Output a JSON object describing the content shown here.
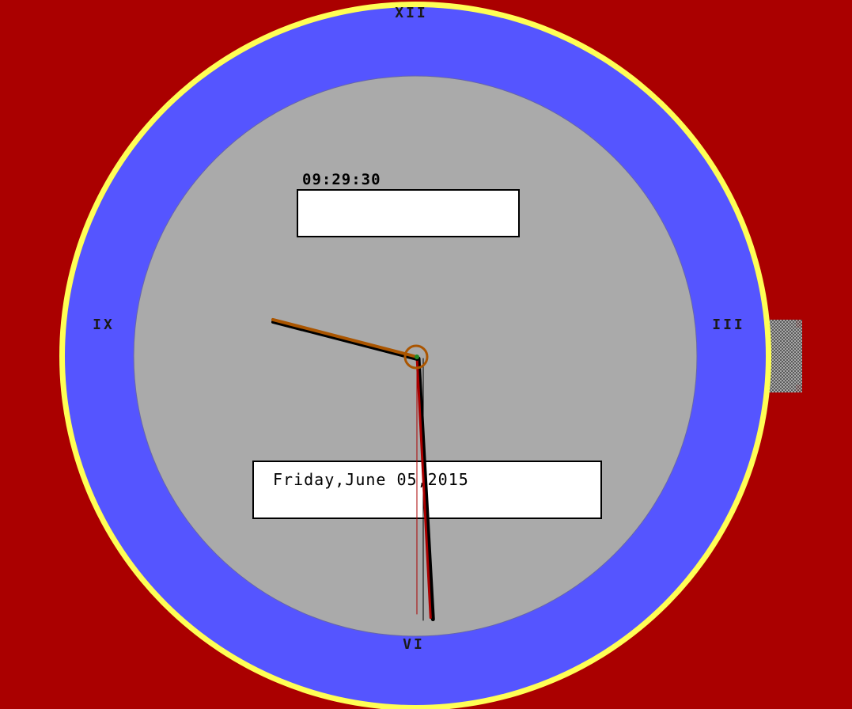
{
  "clock": {
    "digital_time": "09:29:30",
    "date_text": "Friday,June 05,2015",
    "numerals": {
      "twelve": "XII",
      "three": "III",
      "six": "VI",
      "nine": "IX"
    },
    "time": {
      "hour": 9,
      "minute": 29,
      "second": 30
    },
    "colors": {
      "background": "#AA0000",
      "rim": "#FFFF55",
      "bezel": "#5555FF",
      "face": "#AAAAAA",
      "panel": "#FFFFFF",
      "hour_hand": "#AA5500",
      "minute_hand": "#AA0000",
      "second_hand": "#AA0000",
      "hand_shadow": "#000000",
      "crown": "#AAAAAA"
    }
  }
}
